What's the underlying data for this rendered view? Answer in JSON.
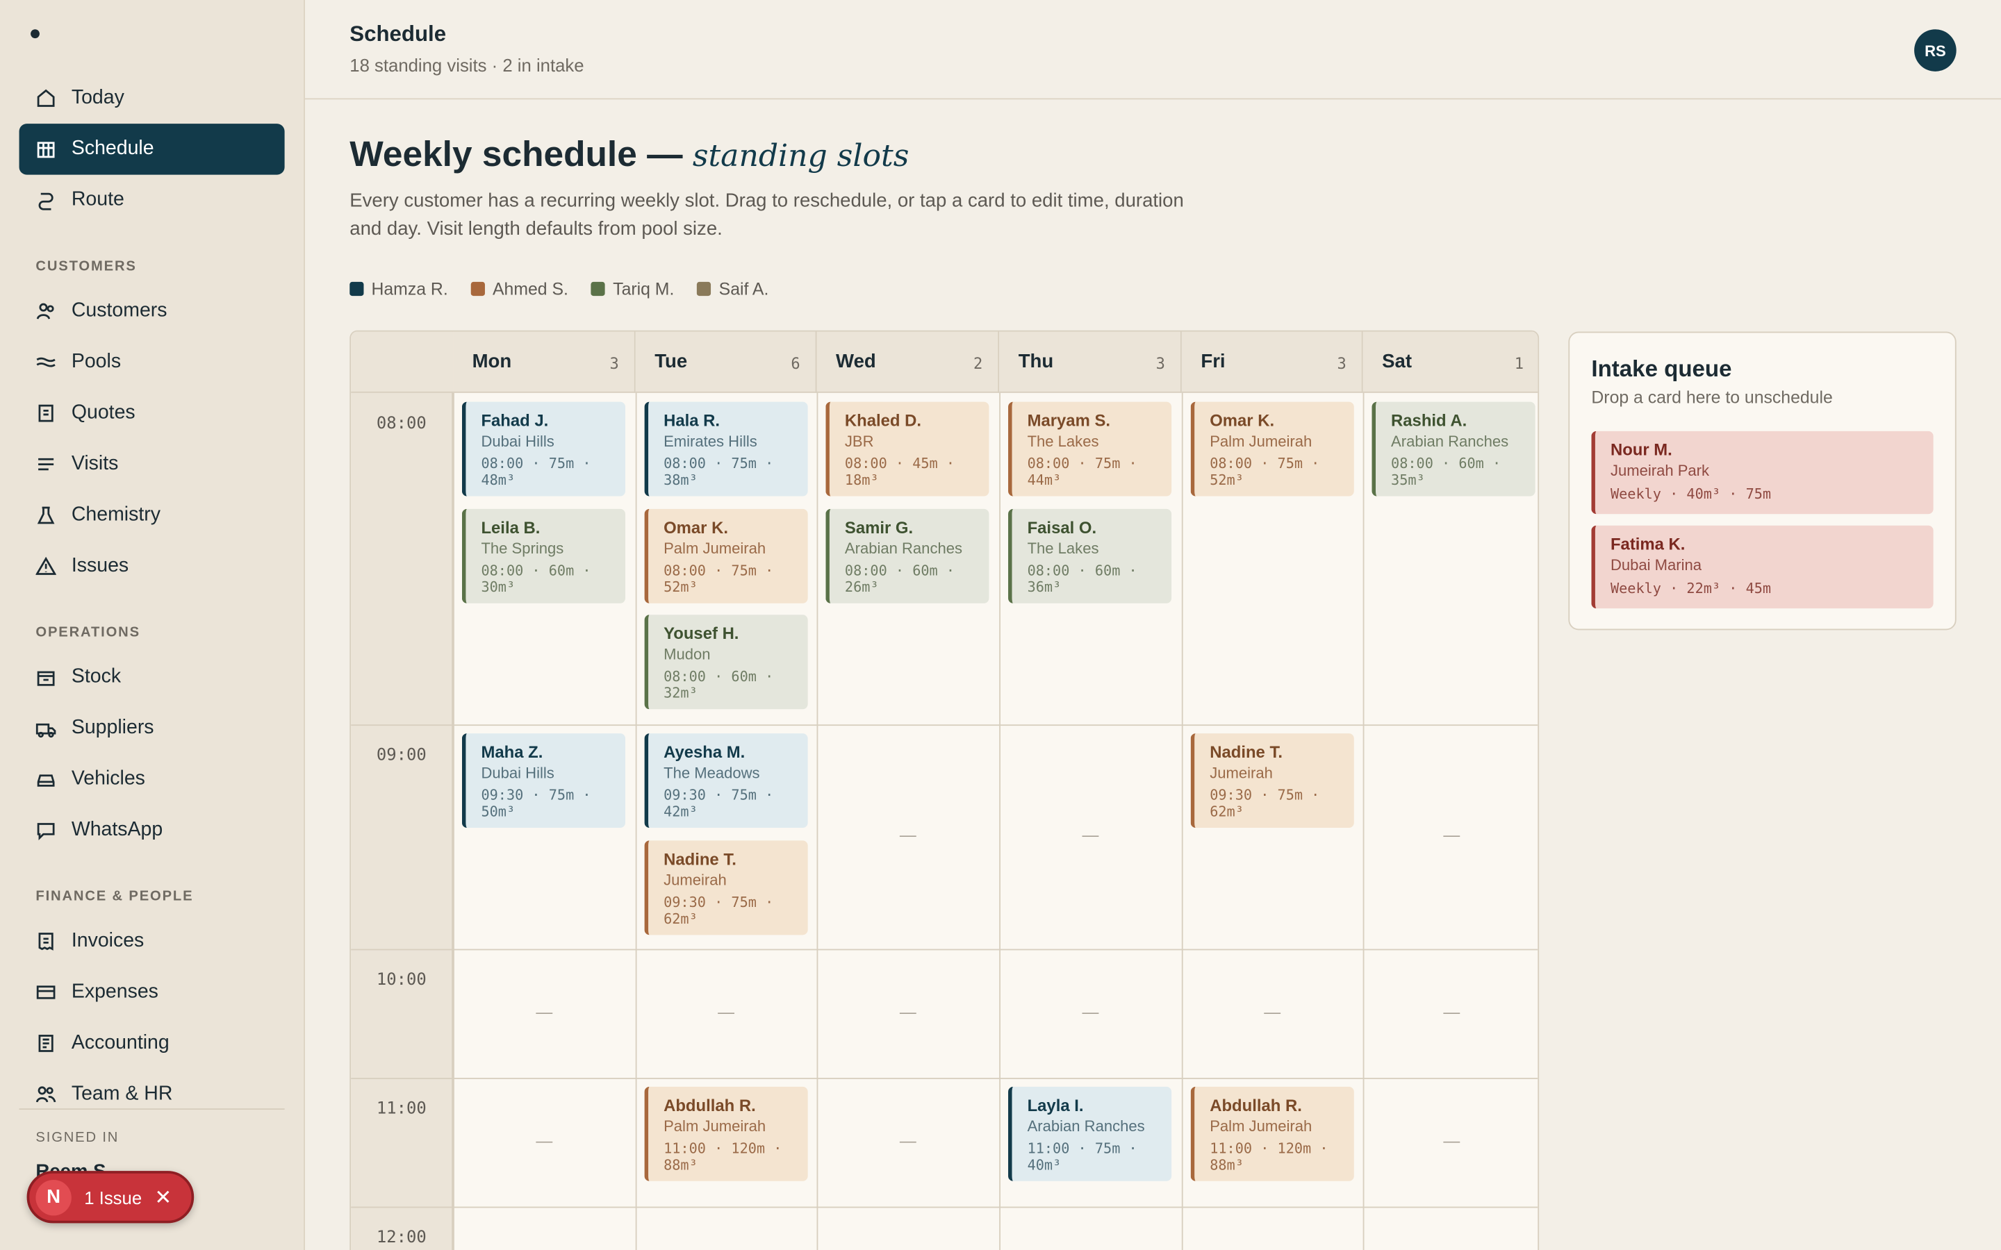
{
  "sidebar": {
    "nav_top": [
      {
        "label": "Today",
        "icon": "home-icon"
      },
      {
        "label": "Schedule",
        "icon": "calendar-grid-icon"
      },
      {
        "label": "Route",
        "icon": "route-icon"
      }
    ],
    "sections": [
      {
        "label": "CUSTOMERS",
        "items": [
          {
            "label": "Customers",
            "icon": "people-icon"
          },
          {
            "label": "Pools",
            "icon": "waves-icon"
          },
          {
            "label": "Quotes",
            "icon": "document-icon"
          },
          {
            "label": "Visits",
            "icon": "list-icon"
          },
          {
            "label": "Chemistry",
            "icon": "flask-icon"
          },
          {
            "label": "Issues",
            "icon": "warning-icon"
          }
        ]
      },
      {
        "label": "OPERATIONS",
        "items": [
          {
            "label": "Stock",
            "icon": "box-icon"
          },
          {
            "label": "Suppliers",
            "icon": "truck-icon"
          },
          {
            "label": "Vehicles",
            "icon": "car-icon"
          },
          {
            "label": "WhatsApp",
            "icon": "chat-icon"
          }
        ]
      },
      {
        "label": "FINANCE & PEOPLE",
        "items": [
          {
            "label": "Invoices",
            "icon": "receipt-icon"
          },
          {
            "label": "Expenses",
            "icon": "card-icon"
          },
          {
            "label": "Accounting",
            "icon": "ledger-icon"
          },
          {
            "label": "Team & HR",
            "icon": "team-icon"
          }
        ]
      }
    ],
    "signed_in_label": "SIGNED IN",
    "signed_in_name": "Reem S.",
    "issue_badge": "N",
    "issue_text": "1 Issue"
  },
  "header": {
    "title": "Schedule",
    "subtitle": "18 standing visits · 2 in intake",
    "avatar": "RS"
  },
  "main": {
    "title": "Weekly schedule —",
    "title_italic": "standing slots",
    "description": "Every customer has a recurring weekly slot. Drag to reschedule, or tap a card to edit time, duration and day. Visit length defaults from pool size."
  },
  "legend": [
    {
      "name": "Hamza R.",
      "color": "#123a4a"
    },
    {
      "name": "Ahmed S.",
      "color": "#a8683c"
    },
    {
      "name": "Tariq M.",
      "color": "#5a7248"
    },
    {
      "name": "Saif A.",
      "color": "#8a7a5a"
    }
  ],
  "days": [
    {
      "name": "Mon",
      "count": "3"
    },
    {
      "name": "Tue",
      "count": "6"
    },
    {
      "name": "Wed",
      "count": "2"
    },
    {
      "name": "Thu",
      "count": "3"
    },
    {
      "name": "Fri",
      "count": "3"
    },
    {
      "name": "Sat",
      "count": "1"
    }
  ],
  "times": [
    "08:00",
    "09:00",
    "10:00",
    "11:00",
    "12:00"
  ],
  "empty_marker": "—",
  "visits": [
    {
      "day": 0,
      "slot": 0,
      "stack": 0,
      "name": "Fahad J.",
      "loc": "Dubai Hills",
      "meta": "08:00 · 75m · 48m³",
      "color": "blue"
    },
    {
      "day": 0,
      "slot": 0,
      "stack": 1,
      "name": "Leila B.",
      "loc": "The Springs",
      "meta": "08:00 · 60m · 30m³",
      "color": "green"
    },
    {
      "day": 1,
      "slot": 0,
      "stack": 0,
      "name": "Hala R.",
      "loc": "Emirates Hills",
      "meta": "08:00 · 75m · 38m³",
      "color": "blue"
    },
    {
      "day": 1,
      "slot": 0,
      "stack": 1,
      "name": "Omar K.",
      "loc": "Palm Jumeirah",
      "meta": "08:00 · 75m · 52m³",
      "color": "orange"
    },
    {
      "day": 1,
      "slot": 0,
      "stack": 2,
      "name": "Yousef H.",
      "loc": "Mudon",
      "meta": "08:00 · 60m · 32m³",
      "color": "green"
    },
    {
      "day": 2,
      "slot": 0,
      "stack": 0,
      "name": "Khaled D.",
      "loc": "JBR",
      "meta": "08:00 · 45m · 18m³",
      "color": "orange"
    },
    {
      "day": 2,
      "slot": 0,
      "stack": 1,
      "name": "Samir G.",
      "loc": "Arabian Ranches",
      "meta": "08:00 · 60m · 26m³",
      "color": "green"
    },
    {
      "day": 3,
      "slot": 0,
      "stack": 0,
      "name": "Maryam S.",
      "loc": "The Lakes",
      "meta": "08:00 · 75m · 44m³",
      "color": "orange"
    },
    {
      "day": 3,
      "slot": 0,
      "stack": 1,
      "name": "Faisal O.",
      "loc": "The Lakes",
      "meta": "08:00 · 60m · 36m³",
      "color": "green"
    },
    {
      "day": 4,
      "slot": 0,
      "stack": 0,
      "name": "Omar K.",
      "loc": "Palm Jumeirah",
      "meta": "08:00 · 75m · 52m³",
      "color": "orange"
    },
    {
      "day": 5,
      "slot": 0,
      "stack": 0,
      "name": "Rashid A.",
      "loc": "Arabian Ranches",
      "meta": "08:00 · 60m · 35m³",
      "color": "green"
    },
    {
      "day": 0,
      "slot": 1,
      "stack": 0,
      "name": "Maha Z.",
      "loc": "Dubai Hills",
      "meta": "09:30 · 75m · 50m³",
      "color": "blue"
    },
    {
      "day": 1,
      "slot": 1,
      "stack": 0,
      "name": "Ayesha M.",
      "loc": "The Meadows",
      "meta": "09:30 · 75m · 42m³",
      "color": "blue"
    },
    {
      "day": 1,
      "slot": 1,
      "stack": 1,
      "name": "Nadine T.",
      "loc": "Jumeirah",
      "meta": "09:30 · 75m · 62m³",
      "color": "orange"
    },
    {
      "day": 4,
      "slot": 1,
      "stack": 0,
      "name": "Nadine T.",
      "loc": "Jumeirah",
      "meta": "09:30 · 75m · 62m³",
      "color": "orange"
    },
    {
      "day": 1,
      "slot": 3,
      "stack": 0,
      "name": "Abdullah R.",
      "loc": "Palm Jumeirah",
      "meta": "11:00 · 120m · 88m³",
      "color": "orange"
    },
    {
      "day": 3,
      "slot": 3,
      "stack": 0,
      "name": "Layla I.",
      "loc": "Arabian Ranches",
      "meta": "11:00 · 75m · 40m³",
      "color": "blue"
    },
    {
      "day": 4,
      "slot": 3,
      "stack": 0,
      "name": "Abdullah R.",
      "loc": "Palm Jumeirah",
      "meta": "11:00 · 120m · 88m³",
      "color": "orange"
    }
  ],
  "intake": {
    "title": "Intake queue",
    "subtitle": "Drop a card here to unschedule",
    "items": [
      {
        "name": "Nour M.",
        "loc": "Jumeirah Park",
        "meta": "Weekly · 40m³ · 75m"
      },
      {
        "name": "Fatima K.",
        "loc": "Dubai Marina",
        "meta": "Weekly · 22m³ · 45m"
      }
    ]
  }
}
